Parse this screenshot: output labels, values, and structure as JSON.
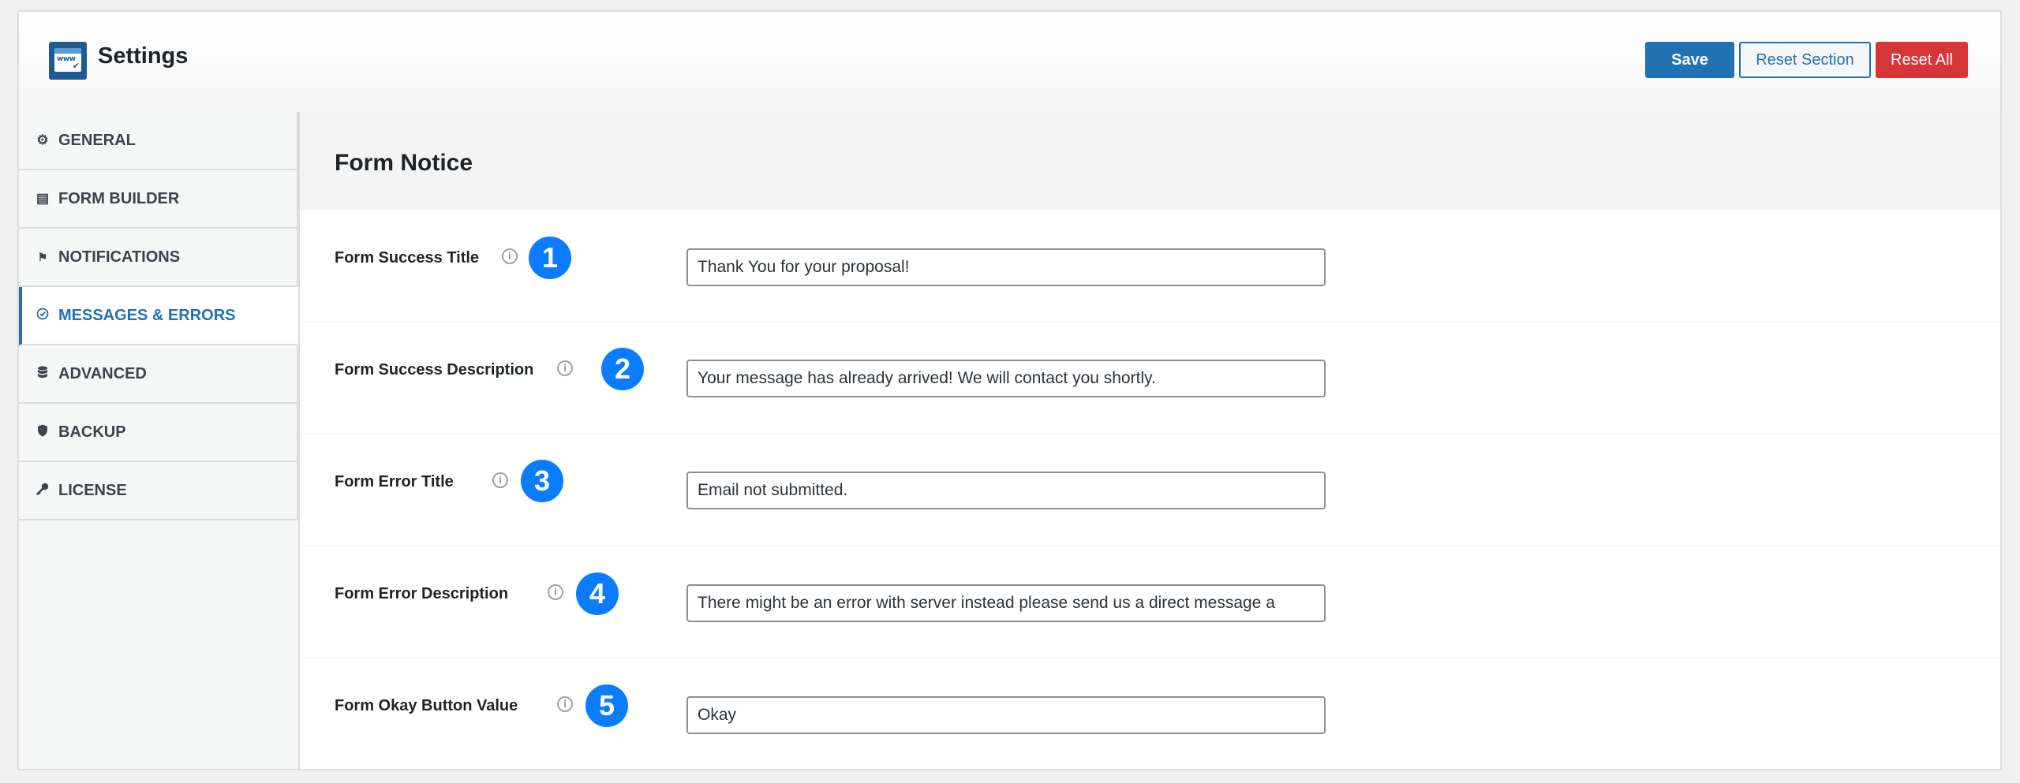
{
  "header": {
    "title": "Settings",
    "logo_text": "www",
    "buttons": {
      "save": "Save",
      "reset_section": "Reset Section",
      "reset_all": "Reset All"
    }
  },
  "sidebar": {
    "items": [
      {
        "label": "GENERAL",
        "icon": "gears-icon",
        "glyph": "⚙"
      },
      {
        "label": "FORM BUILDER",
        "icon": "document-icon",
        "glyph": "▤"
      },
      {
        "label": "NOTIFICATIONS",
        "icon": "bell-icon",
        "glyph": "🔔"
      },
      {
        "label": "MESSAGES & ERRORS",
        "icon": "check-circle-icon",
        "glyph": "⊘",
        "active": true
      },
      {
        "label": "ADVANCED",
        "icon": "database-icon",
        "glyph": "≋"
      },
      {
        "label": "BACKUP",
        "icon": "shield-icon",
        "glyph": "⬢"
      },
      {
        "label": "LICENSE",
        "icon": "key-icon",
        "glyph": "⚷"
      }
    ]
  },
  "main": {
    "section_title": "Form Notice",
    "info_glyph": "i",
    "rows": [
      {
        "label": "Form Success Title",
        "badge": "1",
        "value": "Thank You for your proposal!"
      },
      {
        "label": "Form Success Description",
        "badge": "2",
        "value": "Your message has already arrived! We will contact you shortly."
      },
      {
        "label": "Form Error Title",
        "badge": "3",
        "value": "Email not submitted."
      },
      {
        "label": "Form Error Description",
        "badge": "4",
        "value": "There might be an error with server instead please send us a direct message a"
      },
      {
        "label": "Form Okay Button Value",
        "badge": "5",
        "value": "Okay"
      }
    ]
  },
  "colors": {
    "accent": "#2271b1",
    "danger": "#d63638",
    "badge": "#0b7cff"
  }
}
